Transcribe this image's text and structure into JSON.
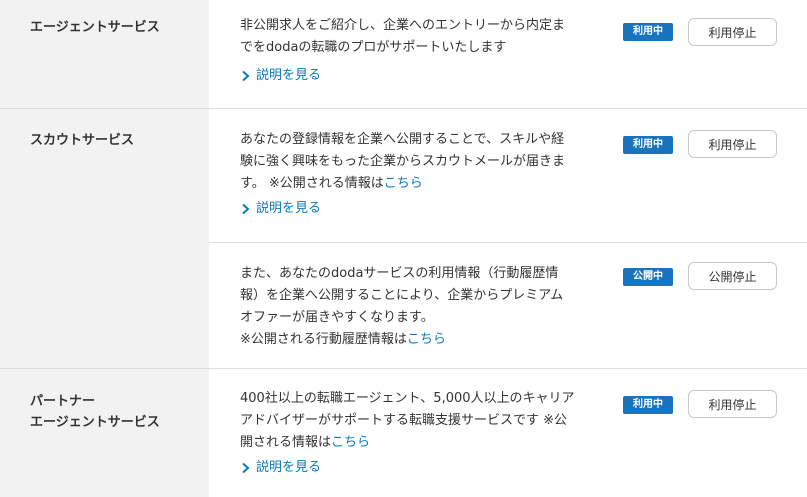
{
  "services": {
    "agent": {
      "name": "エージェントサービス",
      "desc_line1": "非公開求人をご紹介し、企業へのエントリーから内定ま",
      "desc_line2": "でをdodaの転職のプロがサポートいたします",
      "more": "説明を見る",
      "badge": "利用中",
      "button": "利用停止"
    },
    "scout": {
      "name": "スカウトサービス",
      "desc_line1": "あなたの登録情報を企業へ公開することで、スキルや経",
      "desc_line2": "験に強く興味をもった企業からスカウトメールが届きま",
      "desc_line3_pre": "す。 ※公開される情報は",
      "desc_link": "こちら",
      "more": "説明を見る",
      "badge": "利用中",
      "button": "利用停止"
    },
    "scout_sub": {
      "desc_line1": "また、あなたのdodaサービスの利用情報（行動履歴情",
      "desc_line2": "報）を企業へ公開することにより、企業からプレミアム",
      "desc_line3": "オファーが届きやすくなります。",
      "desc_line4_pre": "※公開される行動履歴情報は",
      "desc_link": "こちら",
      "badge": "公開中",
      "button": "公開停止"
    },
    "partner": {
      "name_line1": "パートナー",
      "name_line2": "エージェントサービス",
      "desc_line1": "400社以上の転職エージェント、5,000人以上のキャリア",
      "desc_line2": "アドバイザーがサポートする転職支援サービスです ※公",
      "desc_line3_pre": "開される情報は",
      "desc_link": "こちら",
      "more": "説明を見る",
      "badge": "利用中",
      "button": "利用停止"
    }
  },
  "colors": {
    "accent": "#1a74bd",
    "link": "#0a7ab8",
    "label_bg": "#f2f2f2"
  }
}
